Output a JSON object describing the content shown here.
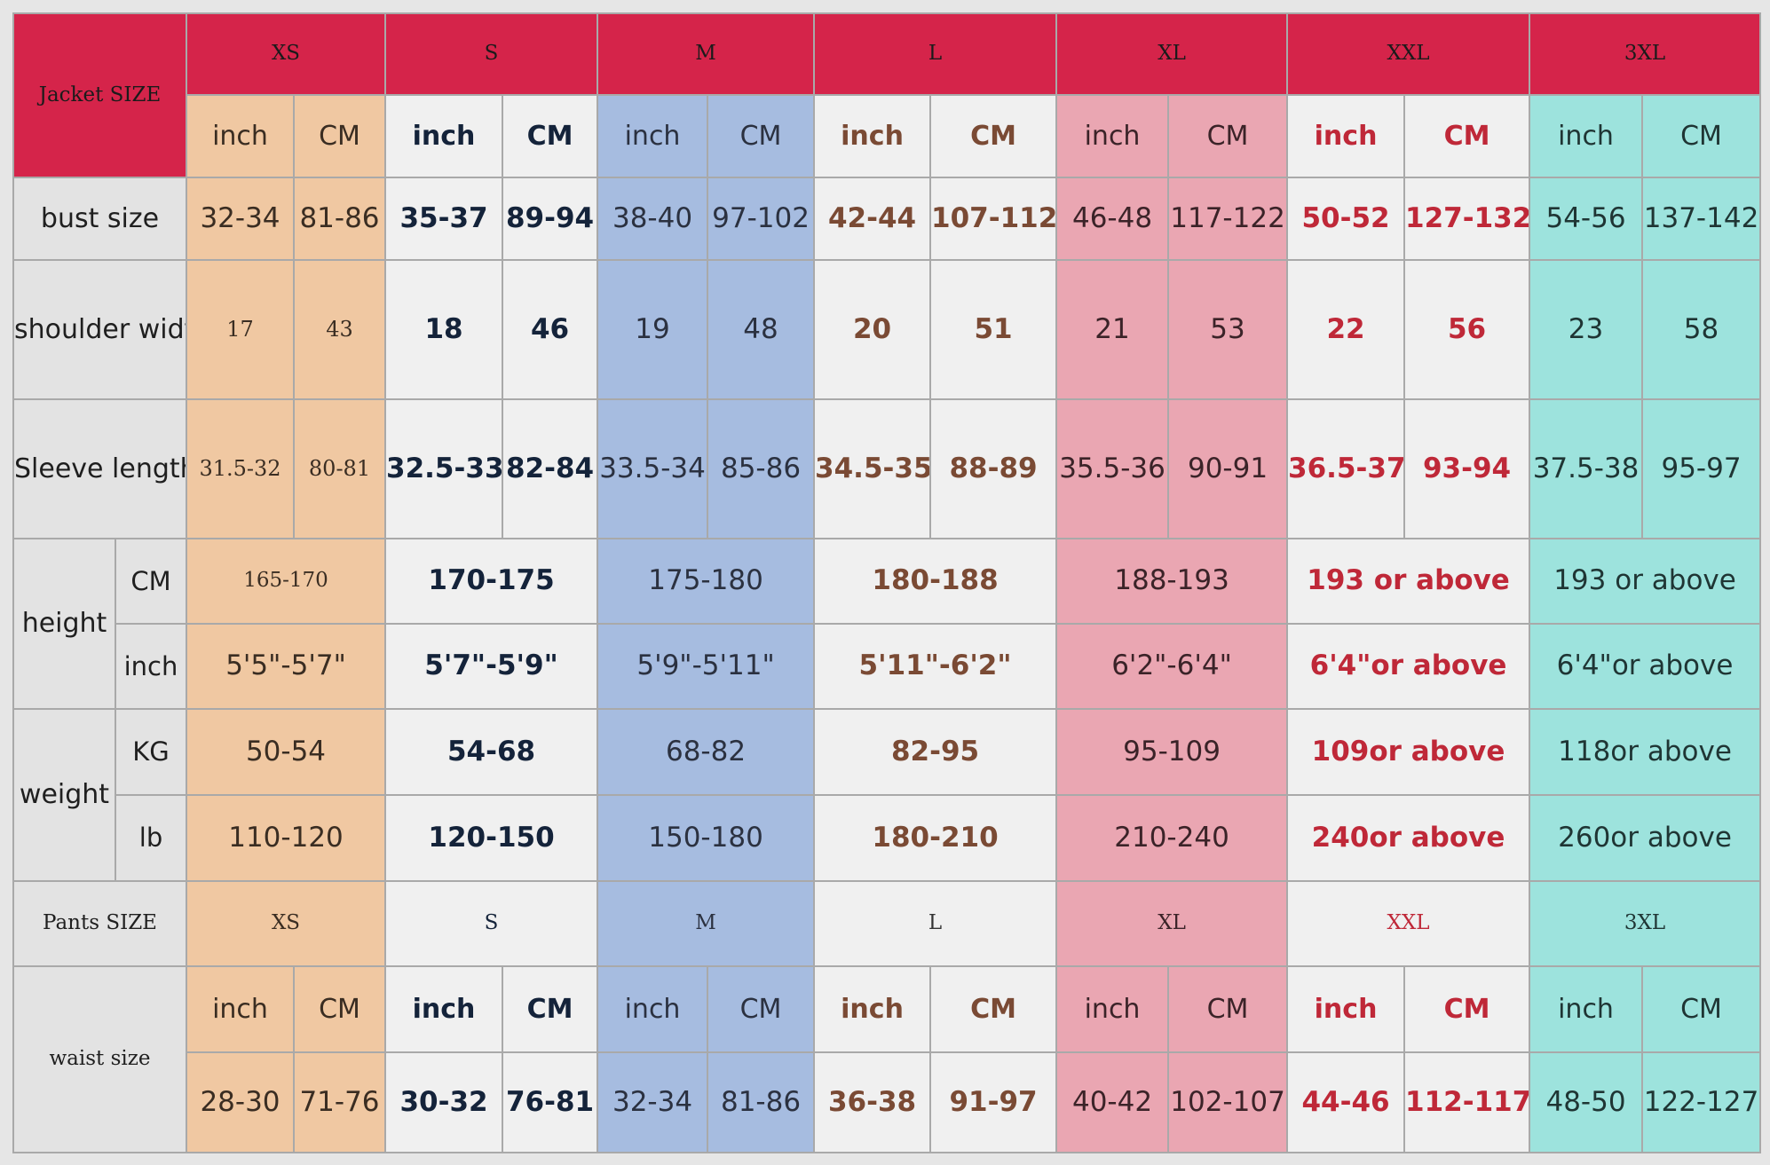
{
  "jacket_label": "Jacket SIZE",
  "sizes": [
    "XS",
    "S",
    "M",
    "L",
    "XL",
    "XXL",
    "3XL"
  ],
  "unit_inch": "inch",
  "unit_cm": "CM",
  "bust": {
    "label": "bust size",
    "values": [
      "32-34",
      "81-86",
      "35-37",
      "89-94",
      "38-40",
      "97-102",
      "42-44",
      "107-112",
      "46-48",
      "117-122",
      "50-52",
      "127-132",
      "54-56",
      "137-142"
    ]
  },
  "shoulder": {
    "label": "shoulder width",
    "values": [
      "17",
      "43",
      "18",
      "46",
      "19",
      "48",
      "20",
      "51",
      "21",
      "53",
      "22",
      "56",
      "23",
      "58"
    ]
  },
  "sleeve": {
    "label": "Sleeve length",
    "values": [
      "31.5-32",
      "80-81",
      "32.5-33",
      "82-84",
      "33.5-34",
      "85-86",
      "34.5-35",
      "88-89",
      "35.5-36",
      "90-91",
      "36.5-37",
      "93-94",
      "37.5-38",
      "95-97"
    ]
  },
  "height": {
    "label": "height",
    "cm_unit": "CM",
    "inch_unit": "inch",
    "cm": [
      "165-170",
      "170-175",
      "175-180",
      "180-188",
      "188-193",
      "193 or above",
      "193 or above"
    ],
    "inch": [
      "5'5\"-5'7\"",
      "5'7\"-5'9\"",
      "5'9\"-5'11\"",
      "5'11\"-6'2\"",
      "6'2\"-6'4\"",
      "6'4\"or above",
      "6'4\"or above"
    ]
  },
  "weight": {
    "label": "weight",
    "kg_unit": "KG",
    "lb_unit": "lb",
    "kg": [
      "50-54",
      "54-68",
      "68-82",
      "82-95",
      "95-109",
      "109or above",
      "118or above"
    ],
    "lb": [
      "110-120",
      "120-150",
      "150-180",
      "180-210",
      "210-240",
      "240or above",
      "260or above"
    ]
  },
  "pants_label": "Pants SIZE",
  "pants_sizes": [
    "XS",
    "S",
    "M",
    "L",
    "XL",
    "XXL",
    "3XL"
  ],
  "waist": {
    "label": "waist size",
    "values": [
      "28-30",
      "71-76",
      "30-32",
      "76-81",
      "32-34",
      "81-86",
      "36-38",
      "91-97",
      "40-42",
      "102-107",
      "44-46",
      "112-117",
      "48-50",
      "122-127"
    ]
  },
  "colors": {
    "header_red": "#d5244a",
    "xs": "#f0c8a2",
    "s": "#f0f0f0",
    "m": "#a6bce0",
    "l": "#f0f0f0",
    "xl": "#eaa6b2",
    "xxl": "#f0f0f0",
    "3xl": "#9de3dd"
  }
}
